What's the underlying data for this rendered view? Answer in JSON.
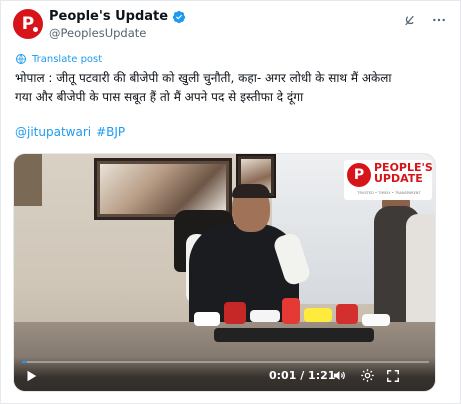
{
  "account": {
    "display_name": "People's Update",
    "handle": "@PeoplesUpdate",
    "avatar_letter": "P",
    "brand_color": "#d7141a",
    "verified": true
  },
  "translate": {
    "label": "Translate post",
    "icon": "globe-icon"
  },
  "post": {
    "text_line1": "भोपाल : जीतू पटवारी की बीजेपी को खुली चुनौती, कहा- अगर लोधी के साथ मैं अकेला",
    "text_line2": "गया और बीजेपी के पास सबूत हैं तो मैं अपने पद से इस्तीफा दे दूंगा",
    "hashtags": [
      "@jitupatwari",
      "#BJP"
    ],
    "link_color": "#1d9bf0"
  },
  "video": {
    "watermark_line1": "PEOPLE'S",
    "watermark_line2": "UPDATE",
    "watermark_tagline": "TRUSTED • TIMELY • TRANSPARENT",
    "time_display": "0:01 / 1:21",
    "progress": 0.012,
    "controls": [
      "play-icon",
      "volume-icon",
      "settings-icon",
      "fullscreen-icon"
    ]
  },
  "top_actions": [
    "grok-icon",
    "more-icon"
  ]
}
